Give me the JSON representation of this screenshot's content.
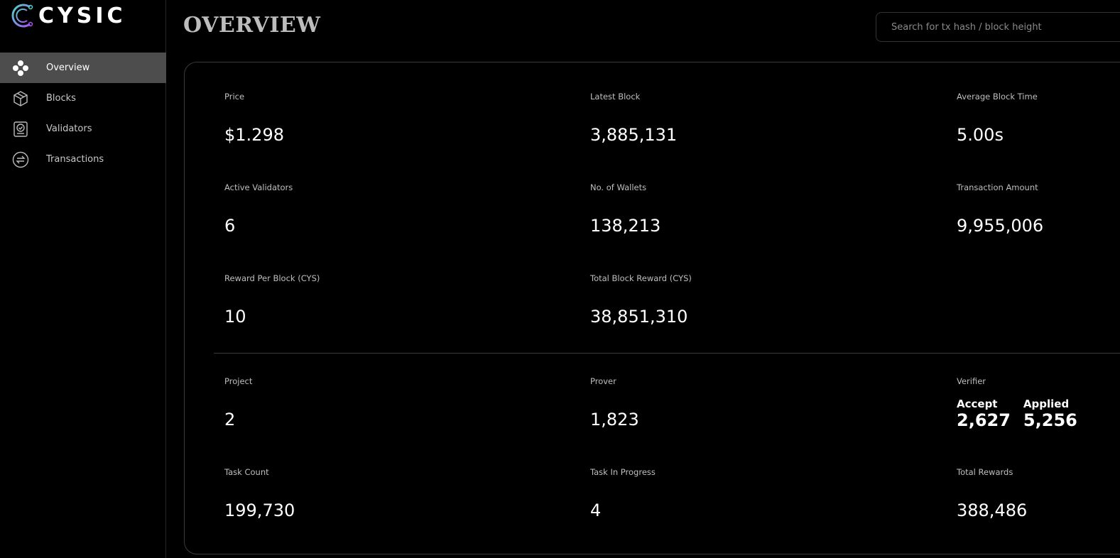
{
  "brand": {
    "name": "CYSIC"
  },
  "sidebar": {
    "items": [
      {
        "label": "Overview",
        "icon": "overview-icon",
        "active": true
      },
      {
        "label": "Blocks",
        "icon": "cube-icon",
        "active": false
      },
      {
        "label": "Validators",
        "icon": "validator-icon",
        "active": false
      },
      {
        "label": "Transactions",
        "icon": "exchange-icon",
        "active": false
      }
    ]
  },
  "header": {
    "title": "OVERVIEW",
    "search_placeholder": "Search for tx hash / block height"
  },
  "stats": {
    "price": {
      "label": "Price",
      "value": "$1.298"
    },
    "latest_block": {
      "label": "Latest Block",
      "value": "3,885,131"
    },
    "avg_block_time": {
      "label": "Average Block Time",
      "value": "5.00s"
    },
    "active_validators": {
      "label": "Active Validators",
      "value": "6"
    },
    "wallets": {
      "label": "No. of Wallets",
      "value": "138,213"
    },
    "tx_amount": {
      "label": "Transaction Amount",
      "value": "9,955,006"
    },
    "reward_per_block": {
      "label": "Reward Per Block (CYS)",
      "value": "10"
    },
    "total_block_reward": {
      "label": "Total Block Reward (CYS)",
      "value": "38,851,310"
    },
    "project": {
      "label": "Project",
      "value": "2"
    },
    "prover": {
      "label": "Prover",
      "value": "1,823"
    },
    "verifier": {
      "label": "Verifier",
      "accept_label": "Accept",
      "accept_value": "2,627",
      "applied_label": "Applied",
      "applied_value": "5,256"
    },
    "task_count": {
      "label": "Task Count",
      "value": "199,730"
    },
    "task_in_progress": {
      "label": "Task In Progress",
      "value": "4"
    },
    "total_rewards": {
      "label": "Total Rewards",
      "value": "388,486"
    }
  },
  "colors": {
    "background": "#000000",
    "active_nav": "#4d4d4d",
    "logo_gradient_start": "#4fd1c5",
    "logo_gradient_end": "#a855f7"
  }
}
